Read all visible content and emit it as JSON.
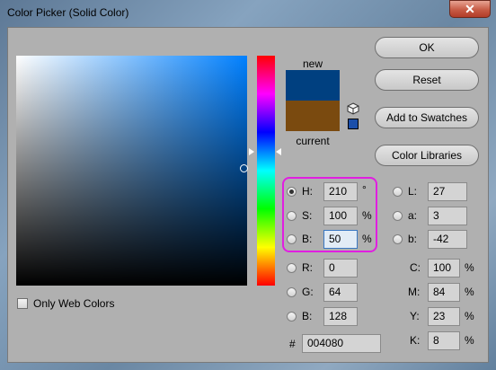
{
  "window": {
    "title": "Color Picker (Solid Color)",
    "close_label": "✕"
  },
  "preview": {
    "new_label": "new",
    "current_label": "current",
    "new_color": "#004080",
    "current_color": "#7a4a0f"
  },
  "buttons": {
    "ok": "OK",
    "reset": "Reset",
    "add_to_swatches": "Add to Swatches",
    "color_libraries": "Color Libraries"
  },
  "only_web_colors": {
    "label": "Only Web Colors",
    "checked": false
  },
  "hsb": {
    "h": {
      "label": "H:",
      "value": "210",
      "unit": "°",
      "selected": true
    },
    "s": {
      "label": "S:",
      "value": "100",
      "unit": "%"
    },
    "b": {
      "label": "B:",
      "value": "50",
      "unit": "%"
    }
  },
  "rgb": {
    "r": {
      "label": "R:",
      "value": "0"
    },
    "g": {
      "label": "G:",
      "value": "64"
    },
    "b": {
      "label": "B:",
      "value": "128"
    }
  },
  "lab": {
    "l": {
      "label": "L:",
      "value": "27"
    },
    "a": {
      "label": "a:",
      "value": "3"
    },
    "b": {
      "label": "b:",
      "value": "-42"
    }
  },
  "cmyk": {
    "c": {
      "label": "C:",
      "value": "100",
      "unit": "%"
    },
    "m": {
      "label": "M:",
      "value": "84",
      "unit": "%"
    },
    "y": {
      "label": "Y:",
      "value": "23",
      "unit": "%"
    },
    "k": {
      "label": "K:",
      "value": "8",
      "unit": "%"
    }
  },
  "hex": {
    "label": "#",
    "value": "004080"
  },
  "colors": {
    "highlight": "#e11ee1",
    "hue_base": "#0080ff"
  }
}
